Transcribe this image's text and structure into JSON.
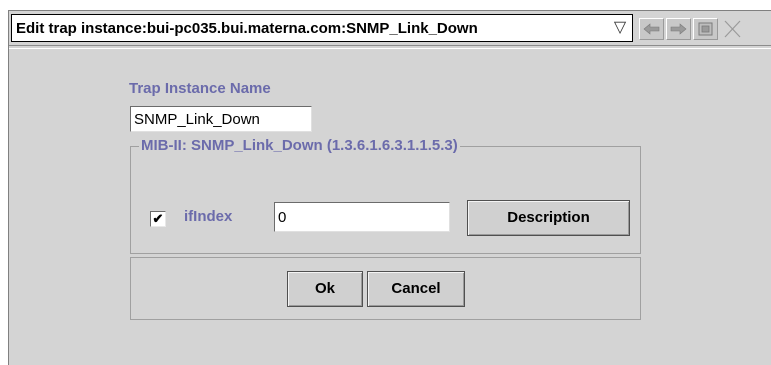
{
  "window": {
    "title": "Edit trap instance:bui-pc035.bui.materna.com:SNMP_Link_Down",
    "dropdown_icon": "triangle-down-icon",
    "toolbar_icons": [
      "back-arrow-icon",
      "forward-arrow-icon",
      "window-icon",
      "close-icon"
    ]
  },
  "form": {
    "trap_instance_label": "Trap Instance Name",
    "trap_instance_value": "SNMP_Link_Down",
    "mib_group_title": "MIB-II: SNMP_Link_Down (1.3.6.1.6.3.1.1.5.3)",
    "ifindex_checked": true,
    "ifindex_label": "ifIndex",
    "ifindex_value": "0",
    "description_button": "Description"
  },
  "actions": {
    "ok_label": "Ok",
    "cancel_label": "Cancel"
  },
  "colors": {
    "background": "#d4d4d4",
    "label": "#6b6bab"
  }
}
